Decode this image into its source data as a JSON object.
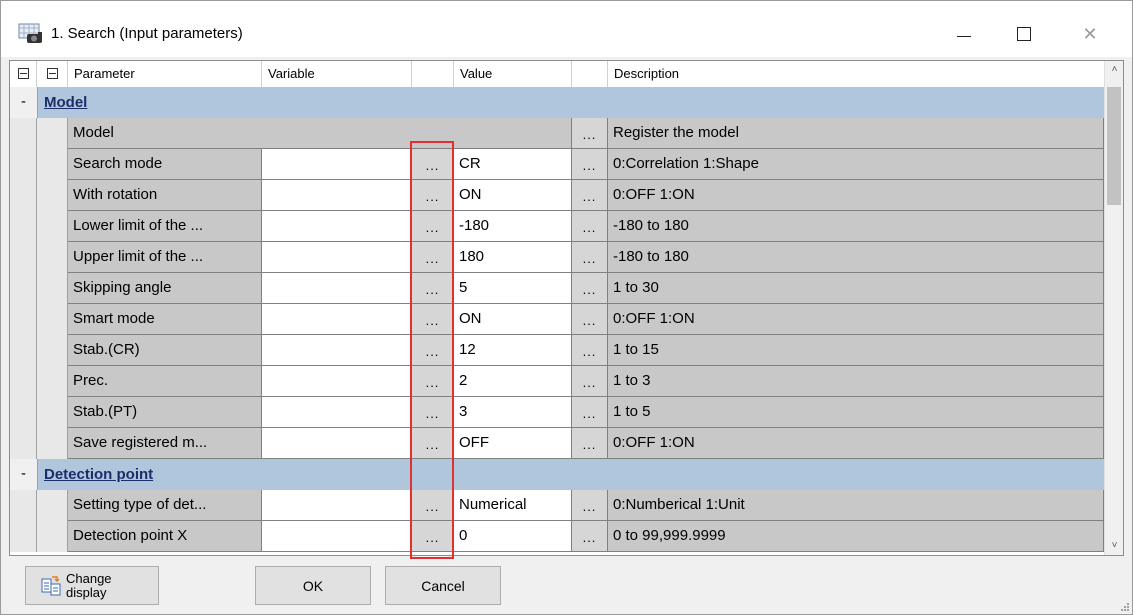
{
  "window": {
    "title": "1. Search (Input parameters)",
    "close_glyph": "✕"
  },
  "grid": {
    "headers": {
      "parameter": "Parameter",
      "variable": "Variable",
      "value": "Value",
      "description": "Description"
    },
    "ellipsis": "...",
    "sections": [
      {
        "toggle": "-",
        "title": "Model",
        "rows": [
          {
            "parameter": "Model",
            "variable": null,
            "value": null,
            "description": "Register the model"
          },
          {
            "parameter": "Search mode",
            "variable": "",
            "value": "CR",
            "description": "0:Correlation 1:Shape"
          },
          {
            "parameter": "With rotation",
            "variable": "",
            "value": "ON",
            "description": "0:OFF 1:ON"
          },
          {
            "parameter": "Lower limit of the ...",
            "variable": "",
            "value": "-180",
            "description": "-180 to 180"
          },
          {
            "parameter": "Upper limit of the ...",
            "variable": "",
            "value": "180",
            "description": "-180 to 180"
          },
          {
            "parameter": "Skipping angle",
            "variable": "",
            "value": "5",
            "description": "1 to 30"
          },
          {
            "parameter": "Smart mode",
            "variable": "",
            "value": "ON",
            "description": "0:OFF 1:ON"
          },
          {
            "parameter": "Stab.(CR)",
            "variable": "",
            "value": "12",
            "description": "1 to 15"
          },
          {
            "parameter": "Prec.",
            "variable": "",
            "value": "2",
            "description": "1 to 3"
          },
          {
            "parameter": "Stab.(PT)",
            "variable": "",
            "value": "3",
            "description": "1 to 5"
          },
          {
            "parameter": "Save registered m...",
            "variable": "",
            "value": "OFF",
            "description": "0:OFF 1:ON"
          }
        ]
      },
      {
        "toggle": "-",
        "title": "Detection point",
        "rows": [
          {
            "parameter": "Setting type of det...",
            "variable": "",
            "value": "Numerical",
            "description": "0:Numberical 1:Unit"
          },
          {
            "parameter": "Detection point X",
            "variable": "",
            "value": "0",
            "description": "0 to 99,999.9999"
          }
        ]
      }
    ]
  },
  "buttons": {
    "change_display_line1": "Change",
    "change_display_line2": "display",
    "ok": "OK",
    "cancel": "Cancel"
  },
  "colors": {
    "section_band": "#b0c6dc",
    "section_title": "#1a2f6a",
    "highlight": "#e03030"
  }
}
